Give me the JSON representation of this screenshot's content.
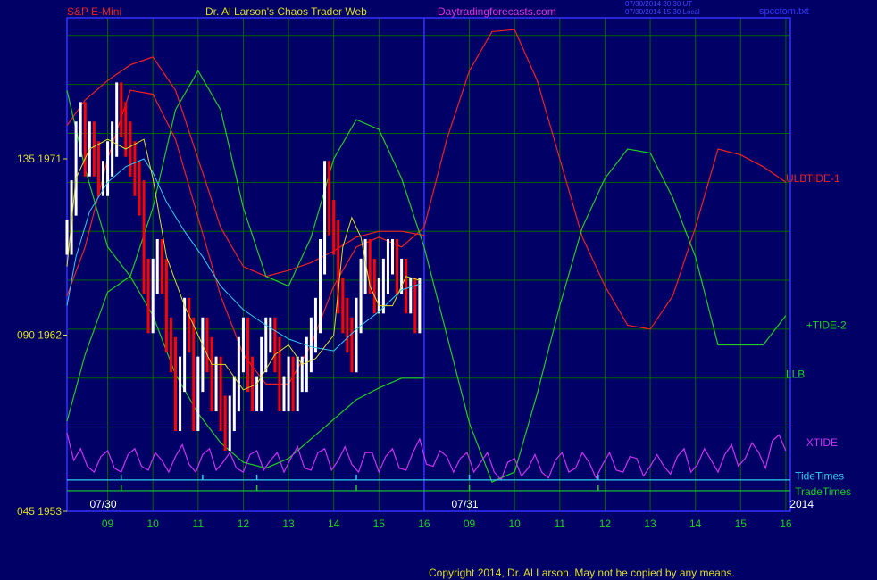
{
  "header": {
    "instrument": "S&P E-Mini",
    "site": "Dr. Al Larson's Chaos Trader Web",
    "url": "Daytradingforecasts.com",
    "stamp1": "07/30/2014 20:30 UT",
    "stamp2": "07/30/2014 15:30 Local",
    "file": "spcctom.txt"
  },
  "footer": {
    "copyright": "Copyright 2014, Dr. Al Larson. May not be copied by any means."
  },
  "colors": {
    "background": "#000066",
    "frame": "#3333ff",
    "grid": "#006600",
    "red": "#ee2222",
    "green": "#22cc22",
    "magenta": "#cc33ee",
    "cyan": "#33ccee",
    "yellow": "#dddd22",
    "price_up": "#ffffff",
    "price_down": "#ff0000"
  },
  "chart_data": {
    "type": "line",
    "y_labels": [
      {
        "text": "135  1971",
        "value": 1971
      },
      {
        "text": "090  1962",
        "value": 1962
      },
      {
        "text": "045  1953",
        "value": 1953
      }
    ],
    "ylim": [
      1953,
      1978.2
    ],
    "x_ticks": [
      "09",
      "10",
      "11",
      "12",
      "13",
      "14",
      "15",
      "16",
      "09",
      "10",
      "11",
      "12",
      "13",
      "14",
      "15",
      "16"
    ],
    "x_tick_hours": [
      9,
      10,
      11,
      12,
      13,
      14,
      15,
      16,
      17,
      18,
      19,
      20,
      21,
      22,
      23,
      24
    ],
    "xlim": [
      8.1,
      24.1
    ],
    "date_labels": [
      {
        "text": "07/30",
        "hour": 8.9
      },
      {
        "text": "07/31",
        "hour": 16.9
      },
      {
        "text": "2014",
        "hour": 24.35
      }
    ],
    "day_dividers": [
      16.0
    ],
    "series": [
      {
        "name": "ULB",
        "color": "red",
        "label_hour": 24.0,
        "label_value": 1970.0
      },
      {
        "name": "TIDE-1",
        "color": "red",
        "label_hour": 24.45,
        "label_value": 1970.0
      },
      {
        "name": "+TIDE-2",
        "color": "green",
        "label_hour": 24.45,
        "label_value": 1962.5
      },
      {
        "name": "LLB",
        "color": "green",
        "label_hour": 24.0,
        "label_value": 1960.0
      },
      {
        "name": "XTIDE",
        "color": "magenta",
        "label_hour": 24.45,
        "label_value": 1956.5
      },
      {
        "name": "TideTimes",
        "color": "cyan",
        "label_hour": 24.2,
        "label_value": 1954.8
      },
      {
        "name": "TradeTimes",
        "color": "green",
        "label_hour": 24.2,
        "label_value": 1954.0
      }
    ],
    "ulb": {
      "x": [
        8.1,
        8.5,
        9.0,
        9.5,
        10.0,
        10.5,
        11.0,
        11.5,
        12.0,
        12.5,
        13.0,
        13.5,
        14.0,
        14.5,
        15.0,
        15.5,
        16.0
      ],
      "y": [
        1972.7,
        1974.0,
        1975.0,
        1975.8,
        1976.2,
        1974.5,
        1971.0,
        1967.5,
        1965.5,
        1965.0,
        1965.3,
        1965.7,
        1966.3,
        1967.0,
        1967.3,
        1967.3,
        1967.1
      ]
    },
    "llb": {
      "x": [
        8.1,
        8.5,
        9.0,
        9.5,
        10.0,
        10.5,
        11.0,
        11.5,
        12.0,
        12.5,
        13.0,
        13.5,
        14.0,
        14.5,
        15.0,
        15.5,
        16.0
      ],
      "y": [
        1957.6,
        1961.0,
        1964.2,
        1965.0,
        1963.0,
        1960.0,
        1958.0,
        1956.5,
        1955.5,
        1955.2,
        1955.7,
        1956.7,
        1957.7,
        1958.7,
        1959.3,
        1959.8,
        1959.8
      ]
    },
    "tide1": {
      "x": [
        8.1,
        8.5,
        9.0,
        9.5,
        10.0,
        10.5,
        11.0,
        11.5,
        12.0,
        12.5,
        13.0,
        13.5,
        14.0,
        14.5,
        15.0,
        15.5,
        16.0,
        16.5,
        17.0,
        17.5,
        18.0,
        18.5,
        19.0,
        19.5,
        20.0,
        20.5,
        21.0,
        21.5,
        22.0,
        22.5,
        23.0,
        23.5,
        24.0
      ],
      "y": [
        1964.0,
        1966.5,
        1971.0,
        1974.5,
        1974.3,
        1972.0,
        1968.0,
        1964.0,
        1961.0,
        1959.5,
        1959.5,
        1961.5,
        1964.5,
        1966.5,
        1967.0,
        1966.5,
        1967.5,
        1972.0,
        1975.5,
        1977.5,
        1977.6,
        1975.0,
        1971.0,
        1967.0,
        1964.5,
        1962.5,
        1962.3,
        1964.0,
        1967.5,
        1971.5,
        1971.2,
        1970.6,
        1969.8
      ]
    },
    "tide2": {
      "x": [
        8.1,
        8.5,
        9.0,
        9.5,
        10.0,
        10.5,
        11.0,
        11.5,
        12.0,
        12.5,
        13.0,
        13.5,
        14.0,
        14.5,
        15.0,
        15.5,
        16.0,
        16.5,
        17.0,
        17.5,
        18.0,
        18.5,
        19.0,
        19.5,
        20.0,
        20.5,
        21.0,
        21.5,
        22.0,
        22.5,
        23.0,
        23.5,
        24.0
      ],
      "y": [
        1974.5,
        1970.5,
        1966.5,
        1965.0,
        1968.5,
        1973.5,
        1975.5,
        1973.5,
        1968.5,
        1965.0,
        1964.5,
        1967.0,
        1971.0,
        1973.0,
        1972.5,
        1970.0,
        1966.5,
        1962.0,
        1957.5,
        1954.5,
        1955.0,
        1959.0,
        1963.5,
        1967.5,
        1970.0,
        1971.5,
        1971.3,
        1969.0,
        1966.0,
        1961.5,
        1961.5,
        1961.5,
        1963.0
      ]
    },
    "ma_slow": {
      "x": [
        8.1,
        8.3,
        8.6,
        9.0,
        9.4,
        9.8,
        10.0,
        10.3,
        10.7,
        11.1,
        11.5,
        12.0,
        12.5,
        13.0,
        13.5,
        14.0,
        14.5,
        15.0,
        15.5,
        15.9
      ],
      "y": [
        1963.5,
        1966.0,
        1968.3,
        1969.8,
        1970.6,
        1971.0,
        1970.3,
        1968.8,
        1967.3,
        1966.0,
        1964.5,
        1963.3,
        1962.5,
        1961.8,
        1961.4,
        1961.2,
        1962.3,
        1963.2,
        1964.3,
        1964.6
      ]
    },
    "ma_fast": {
      "x": [
        8.1,
        8.3,
        8.6,
        9.0,
        9.4,
        9.8,
        10.0,
        10.3,
        10.7,
        11.0,
        11.3,
        11.6,
        12.0,
        12.3,
        12.7,
        13.0,
        13.3,
        13.6,
        14.0,
        14.2,
        14.4,
        14.6,
        14.8,
        15.0,
        15.3,
        15.6,
        15.9
      ],
      "y": [
        1965.5,
        1970.0,
        1971.5,
        1972.0,
        1971.5,
        1972.0,
        1970.0,
        1966.0,
        1963.5,
        1962.0,
        1960.5,
        1960.5,
        1959.2,
        1959.5,
        1961.0,
        1961.5,
        1960.5,
        1960.8,
        1962.0,
        1966.5,
        1968.0,
        1967.0,
        1964.5,
        1963.5,
        1963.5,
        1965.0,
        1964.8
      ]
    },
    "price": {
      "x": [
        8.1,
        8.2,
        8.3,
        8.4,
        8.5,
        8.6,
        8.7,
        8.8,
        8.9,
        9.0,
        9.1,
        9.2,
        9.3,
        9.4,
        9.5,
        9.6,
        9.7,
        9.8,
        9.9,
        10.0,
        10.1,
        10.2,
        10.3,
        10.4,
        10.5,
        10.6,
        10.7,
        10.8,
        10.9,
        11.0,
        11.1,
        11.2,
        11.3,
        11.4,
        11.5,
        11.6,
        11.7,
        11.8,
        11.9,
        12.0,
        12.1,
        12.2,
        12.3,
        12.4,
        12.5,
        12.6,
        12.7,
        12.8,
        12.9,
        13.0,
        13.1,
        13.2,
        13.3,
        13.4,
        13.5,
        13.6,
        13.7,
        13.8,
        13.9,
        14.0,
        14.1,
        14.2,
        14.3,
        14.4,
        14.5,
        14.6,
        14.7,
        14.8,
        14.9,
        15.0,
        15.1,
        15.2,
        15.3,
        15.4,
        15.5,
        15.6,
        15.7,
        15.8,
        15.9
      ],
      "y": [
        1967,
        1969,
        1972,
        1973,
        1971,
        1972,
        1971,
        1970,
        1970,
        1971,
        1972,
        1974,
        1973,
        1972,
        1971,
        1970,
        1969,
        1965,
        1963,
        1965,
        1966,
        1965,
        1962,
        1961,
        1958,
        1960,
        1963,
        1962,
        1958,
        1960,
        1962,
        1961,
        1959,
        1960,
        1958,
        1957,
        1958,
        1959,
        1961,
        1962,
        1960,
        1959,
        1959,
        1961,
        1962,
        1962,
        1961,
        1959,
        1959,
        1960,
        1959,
        1960,
        1960,
        1961,
        1962,
        1963,
        1966,
        1970,
        1968,
        1967,
        1964,
        1963,
        1962,
        1961,
        1963,
        1965,
        1966,
        1965,
        1964,
        1964,
        1965,
        1966,
        1966,
        1965,
        1965,
        1964,
        1964,
        1963,
        1964
      ]
    },
    "xtide": {
      "x": [
        8.1,
        8.25,
        8.4,
        8.55,
        8.7,
        8.85,
        9.0,
        9.15,
        9.3,
        9.45,
        9.6,
        9.75,
        9.9,
        10.05,
        10.2,
        10.35,
        10.5,
        10.65,
        10.8,
        10.95,
        11.1,
        11.25,
        11.4,
        11.55,
        11.7,
        11.85,
        12.0,
        12.15,
        12.3,
        12.45,
        12.6,
        12.75,
        12.9,
        13.05,
        13.2,
        13.35,
        13.5,
        13.65,
        13.8,
        13.95,
        14.1,
        14.25,
        14.4,
        14.55,
        14.7,
        14.85,
        15.0,
        15.15,
        15.3,
        15.45,
        15.6,
        15.75,
        15.9,
        16.05,
        16.2,
        16.35,
        16.5,
        16.65,
        16.8,
        16.95,
        17.1,
        17.25,
        17.4,
        17.55,
        17.7,
        17.85,
        18.0,
        18.15,
        18.3,
        18.45,
        18.6,
        18.75,
        18.9,
        19.05,
        19.2,
        19.35,
        19.5,
        19.65,
        19.8,
        19.95,
        20.1,
        20.25,
        20.4,
        20.55,
        20.7,
        20.85,
        21.0,
        21.15,
        21.3,
        21.45,
        21.6,
        21.75,
        21.9,
        22.05,
        22.2,
        22.35,
        22.5,
        22.65,
        22.8,
        22.95,
        23.1,
        23.25,
        23.4,
        23.55,
        23.7,
        23.85,
        24.0
      ],
      "y": [
        1957.0,
        1955.6,
        1956.2,
        1955.3,
        1955.0,
        1955.8,
        1956.1,
        1955.2,
        1955.0,
        1955.9,
        1956.2,
        1955.3,
        1955.1,
        1956.0,
        1955.6,
        1955.0,
        1955.8,
        1956.4,
        1955.4,
        1955.0,
        1955.9,
        1956.2,
        1955.1,
        1955.5,
        1956.0,
        1955.2,
        1955.0,
        1955.9,
        1956.1,
        1955.1,
        1955.6,
        1956.0,
        1955.0,
        1955.7,
        1956.3,
        1955.2,
        1955.1,
        1956.0,
        1956.2,
        1955.1,
        1955.6,
        1956.3,
        1955.4,
        1955.0,
        1956.0,
        1956.0,
        1955.0,
        1955.8,
        1956.2,
        1955.2,
        1955.1,
        1956.0,
        1956.7,
        1955.4,
        1955.3,
        1956.1,
        1955.8,
        1955.0,
        1955.7,
        1956.0,
        1955.0,
        1955.5,
        1956.0,
        1955.0,
        1954.6,
        1955.5,
        1955.7,
        1954.8,
        1955.2,
        1955.9,
        1955.0,
        1954.7,
        1955.6,
        1956.0,
        1955.0,
        1955.2,
        1956.0,
        1955.5,
        1954.7,
        1955.4,
        1956.0,
        1955.1,
        1955.0,
        1955.8,
        1955.7,
        1954.8,
        1955.3,
        1955.9,
        1955.3,
        1954.9,
        1955.8,
        1956.2,
        1955.0,
        1955.4,
        1956.2,
        1955.6,
        1955.0,
        1955.9,
        1956.4,
        1955.3,
        1955.7,
        1956.5,
        1956.0,
        1955.2,
        1956.6,
        1956.9,
        1956.1
      ]
    },
    "tide_times": {
      "baseline": 1954.6,
      "marks": [
        9.3,
        11.1,
        12.3,
        14.5,
        17.0,
        19.85
      ]
    },
    "trade_times": {
      "baseline": 1954.05,
      "marks": [
        9.3,
        12.3,
        14.5,
        17.0,
        19.85
      ]
    }
  }
}
